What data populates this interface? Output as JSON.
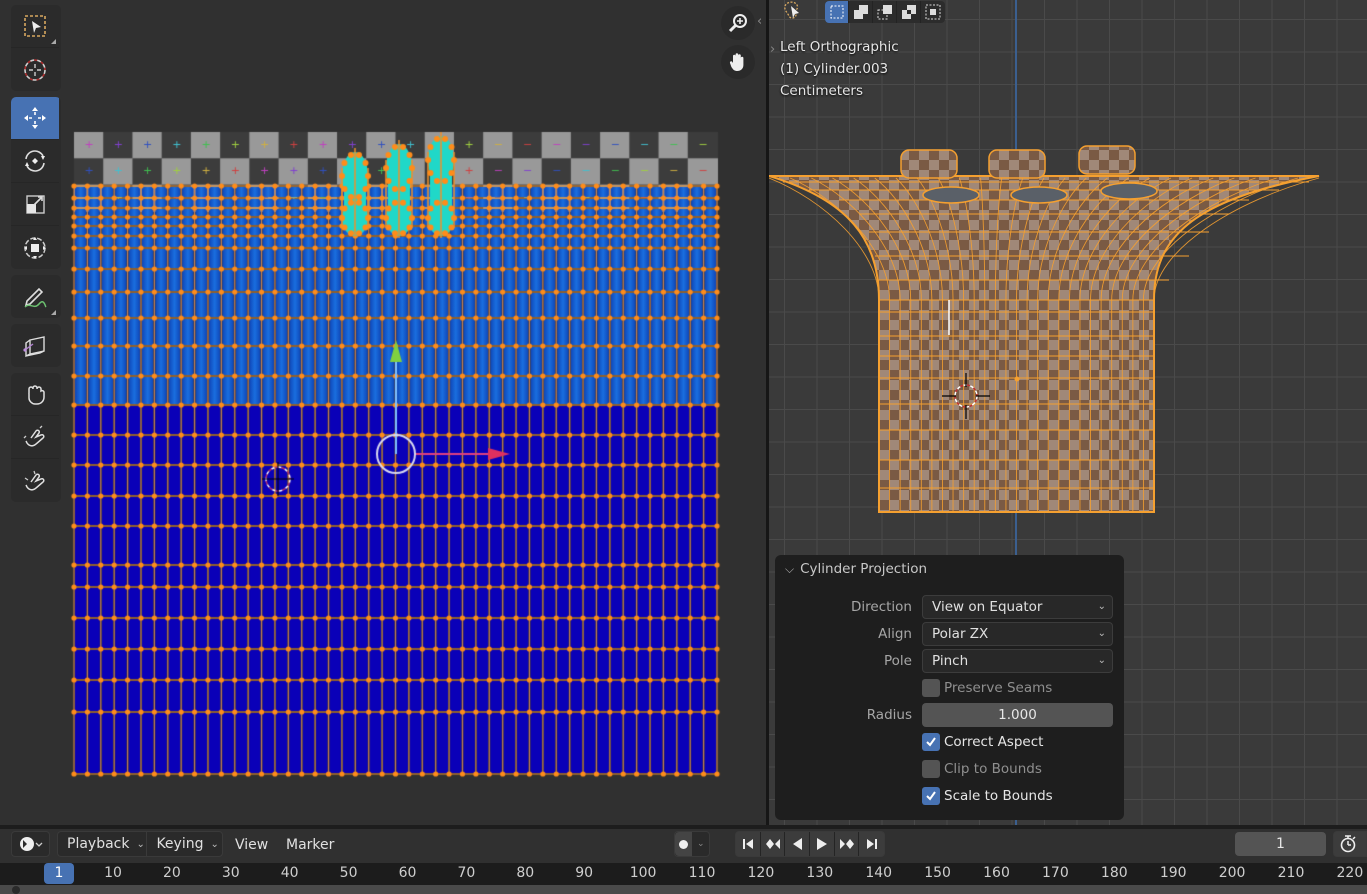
{
  "uv_editor": {
    "toolbar": [
      {
        "name": "select-box",
        "icon": "select-box-icon",
        "active": false,
        "has_submenu": true
      },
      {
        "name": "cursor",
        "icon": "cursor-icon",
        "active": false
      },
      {
        "name": "move",
        "icon": "move-icon",
        "active": true
      },
      {
        "name": "rotate",
        "icon": "rotate-icon",
        "active": false
      },
      {
        "name": "scale",
        "icon": "scale-icon",
        "active": false
      },
      {
        "name": "transform",
        "icon": "transform-icon",
        "active": false
      },
      {
        "name": "annotate",
        "icon": "annotate-icon",
        "active": false,
        "has_submenu": true
      },
      {
        "name": "rip-region",
        "icon": "rip-region-icon",
        "active": false
      },
      {
        "name": "grab",
        "icon": "grab-icon",
        "active": false
      },
      {
        "name": "relax",
        "icon": "relax-icon",
        "active": false
      },
      {
        "name": "pinch",
        "icon": "pinch-icon",
        "active": false
      }
    ],
    "nav": {
      "zoom_icon": "zoom-icon",
      "pan_icon": "hand-icon"
    },
    "mesh": {
      "face_color_top": "#1560d0",
      "face_color_bottom": "#0a00b8",
      "island_color": "#20d8c8",
      "edge_color": "#f0902a",
      "vertex_color": "#ff8c1a",
      "checker_colors": [
        "#3c3c3c",
        "#999999"
      ]
    }
  },
  "viewport": {
    "view_name": "Left Orthographic",
    "object": "(1) Cylinder.003",
    "units": "Centimeters",
    "select_modes": [
      "set",
      "extend",
      "subtract",
      "difference",
      "intersect"
    ],
    "active_select_mode": "set"
  },
  "panel": {
    "title": "Cylinder Projection",
    "direction": {
      "label": "Direction",
      "value": "View on Equator"
    },
    "align": {
      "label": "Align",
      "value": "Polar ZX"
    },
    "pole": {
      "label": "Pole",
      "value": "Pinch"
    },
    "preserve_seams": {
      "label": "Preserve Seams",
      "checked": false
    },
    "radius": {
      "label": "Radius",
      "value": "1.000"
    },
    "correct_aspect": {
      "label": "Correct Aspect",
      "checked": true
    },
    "clip_to_bounds": {
      "label": "Clip to Bounds",
      "checked": false
    },
    "scale_to_bounds": {
      "label": "Scale to Bounds",
      "checked": true
    }
  },
  "timeline": {
    "menus": {
      "playback": "Playback",
      "keying": "Keying",
      "view": "View",
      "marker": "Marker"
    },
    "current_frame": "1",
    "frame_field": "1",
    "ruler_ticks": [
      "10",
      "20",
      "30",
      "40",
      "50",
      "60",
      "70",
      "80",
      "90",
      "100",
      "110",
      "120",
      "130",
      "140",
      "150",
      "160",
      "170",
      "180",
      "190",
      "200",
      "210",
      "220"
    ]
  },
  "colors": {
    "accent": "#4772b3",
    "selection": "#f0902a"
  }
}
